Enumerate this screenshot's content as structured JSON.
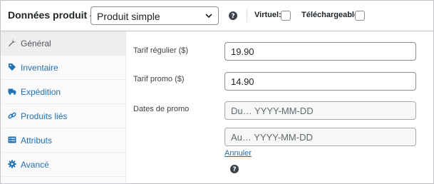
{
  "header": {
    "title": "Données produit —",
    "product_type": "Produit simple",
    "virtual_label": "Virtuel:",
    "downloadable_label": "Téléchargeable:"
  },
  "sidebar": {
    "items": [
      {
        "label": "Général",
        "icon": "wrench-icon",
        "active": true
      },
      {
        "label": "Inventaire",
        "icon": "tag-icon",
        "active": false
      },
      {
        "label": "Expédition",
        "icon": "truck-icon",
        "active": false
      },
      {
        "label": "Produits liés",
        "icon": "link-icon",
        "active": false
      },
      {
        "label": "Attributs",
        "icon": "list-icon",
        "active": false
      },
      {
        "label": "Avancé",
        "icon": "gear-icon",
        "active": false
      }
    ]
  },
  "fields": {
    "regular_price_label": "Tarif régulier ($)",
    "regular_price_value": "19.90",
    "sale_price_label": "Tarif promo ($)",
    "sale_price_value": "14.90",
    "sale_dates_label": "Dates de promo",
    "date_from_placeholder": "Du… YYYY-MM-DD",
    "date_to_placeholder": "Au… YYYY-MM-DD",
    "cancel_link": "Annuler"
  },
  "colors": {
    "link": "#2271b1",
    "border": "#c3c4c7",
    "sidebar_bg": "#fafafa",
    "active_item_bg": "#eeeeee"
  }
}
